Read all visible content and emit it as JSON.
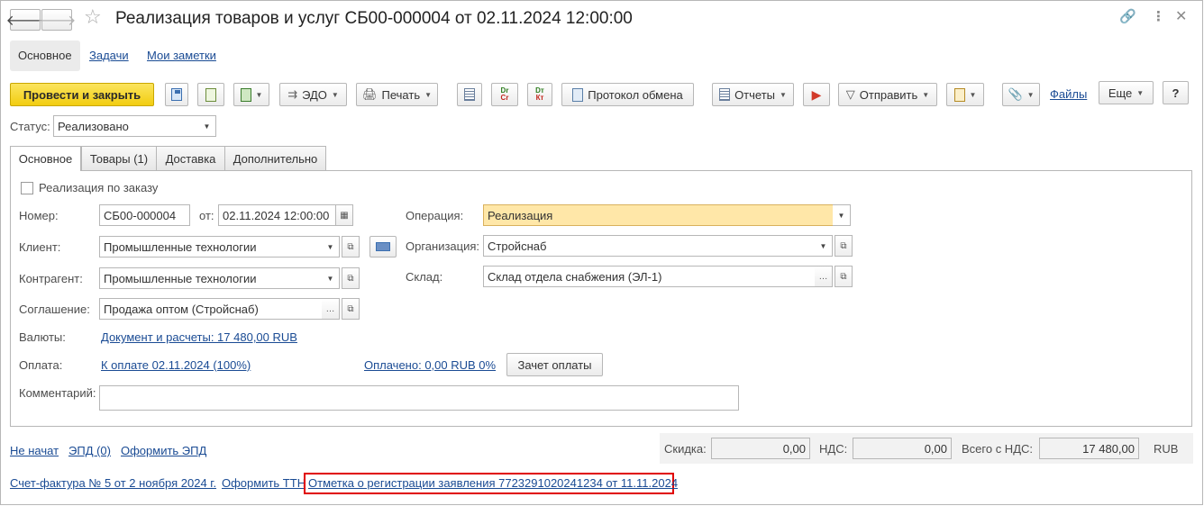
{
  "window": {
    "title": "Реализация товаров и услуг СБ00-000004 от 02.11.2024 12:00:00"
  },
  "nav": {
    "back_icon": "arrow-left-icon",
    "forward_icon": "arrow-right-icon"
  },
  "sections": {
    "main": "Основное",
    "tasks": "Задачи",
    "notes": "Мои заметки"
  },
  "toolbar": {
    "post_close": "Провести и закрыть",
    "edo": "ЭДО",
    "print": "Печать",
    "exchange_log": "Протокол обмена",
    "reports": "Отчеты",
    "send": "Отправить",
    "files": "Файлы",
    "more": "Еще",
    "help": "?",
    "dt_top": "Dт",
    "dt_bottom": "Кт",
    "dr_top": "Dr",
    "dr_bottom": "Cr"
  },
  "status": {
    "label": "Статус:",
    "value": "Реализовано"
  },
  "tabs": [
    "Основное",
    "Товары (1)",
    "Доставка",
    "Дополнительно"
  ],
  "form": {
    "by_order": "Реализация по заказу",
    "number_label": "Номер:",
    "number": "СБ00-000004",
    "date_label": "от:",
    "date": "02.11.2024 12:00:00",
    "client_label": "Клиент:",
    "client": "Промышленные технологии",
    "counterparty_label": "Контрагент:",
    "counterparty": "Промышленные технологии",
    "agreement_label": "Соглашение:",
    "agreement": "Продажа оптом (Стройснаб)",
    "currency_label": "Валюты:",
    "currency_link": "Документ и расчеты: 17 480,00 RUB",
    "payment_label": "Оплата:",
    "payment_link": "К оплате 02.11.2024 (100%)",
    "paid_link": "Оплачено: 0,00 RUB 0%",
    "offset_button": "Зачет оплаты",
    "comment_label": "Комментарий:",
    "comment": "",
    "operation_label": "Операция:",
    "operation": "Реализация",
    "org_label": "Организация:",
    "org": "Стройснаб",
    "warehouse_label": "Склад:",
    "warehouse": "Склад отдела снабжения (ЭЛ-1)"
  },
  "footer": {
    "not_started": "Не начат",
    "epd": "ЭПД (0)",
    "make_epd": "Оформить ЭПД",
    "discount_label": "Скидка:",
    "discount": "0,00",
    "vat_label": "НДС:",
    "vat": "0,00",
    "total_label": "Всего с НДС:",
    "total": "17 480,00",
    "currency": "RUB",
    "invoice_link": "Счет-фактура № 5 от 2 ноября 2024 г.",
    "ttn_link": "Оформить ТТН",
    "registration_link": "Отметка о регистрации заявления 7723291020241234 от 11.11.2024"
  },
  "colors": {
    "accent_yellow": "#f2cd10",
    "link_blue": "#1a4b94",
    "highlight_field": "#ffe7a8",
    "red_frame": "#e00000"
  }
}
